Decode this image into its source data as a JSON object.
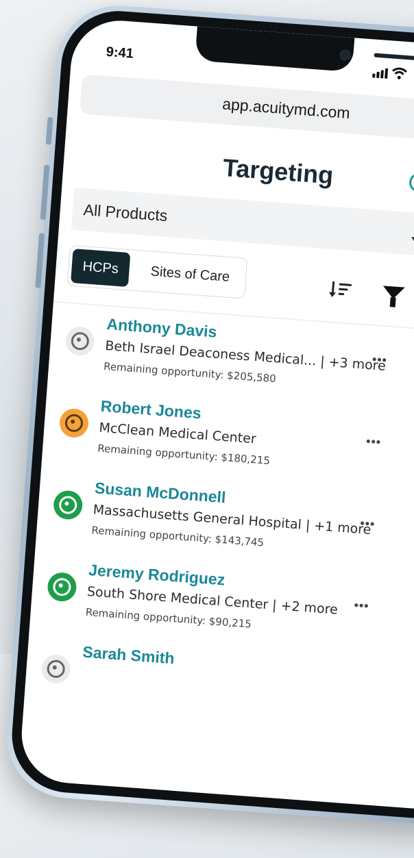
{
  "status_bar": {
    "time": "9:41"
  },
  "browser": {
    "url": "app.acuitymd.com"
  },
  "page": {
    "title": "Targeting"
  },
  "filters": {
    "product_select": "All Products",
    "segments": [
      "HCPs",
      "Sites of Care"
    ],
    "active_segment": "HCPs"
  },
  "colors": {
    "accent": "#1a8897",
    "dark_segment": "#14282f",
    "priority_orange": "#f4a23a",
    "priority_green": "#1e9e4a",
    "priority_gray": "#e9ebed"
  },
  "list": {
    "more_label": "•••",
    "items": [
      {
        "name": "Anthony Davis",
        "site": "Beth Israel Deaconess Medical... | +3 more",
        "opportunity": "Remaining opportunity: $205,580",
        "status": "gray",
        "icon": "target-icon"
      },
      {
        "name": "Robert Jones",
        "site": "McClean Medical Center",
        "opportunity": "Remaining opportunity: $180,215",
        "status": "orange",
        "icon": "target-icon"
      },
      {
        "name": "Susan McDonnell",
        "site": "Massachusetts General Hospital | +1 more",
        "opportunity": "Remaining opportunity: $143,745",
        "status": "green",
        "icon": "target-icon"
      },
      {
        "name": "Jeremy Rodriguez",
        "site": "South Shore Medical Center | +2 more",
        "opportunity": "Remaining opportunity: $90,215",
        "status": "green",
        "icon": "target-icon"
      },
      {
        "name": "Sarah Smith",
        "site": "",
        "opportunity": "",
        "status": "gray",
        "icon": "target-icon"
      }
    ]
  }
}
